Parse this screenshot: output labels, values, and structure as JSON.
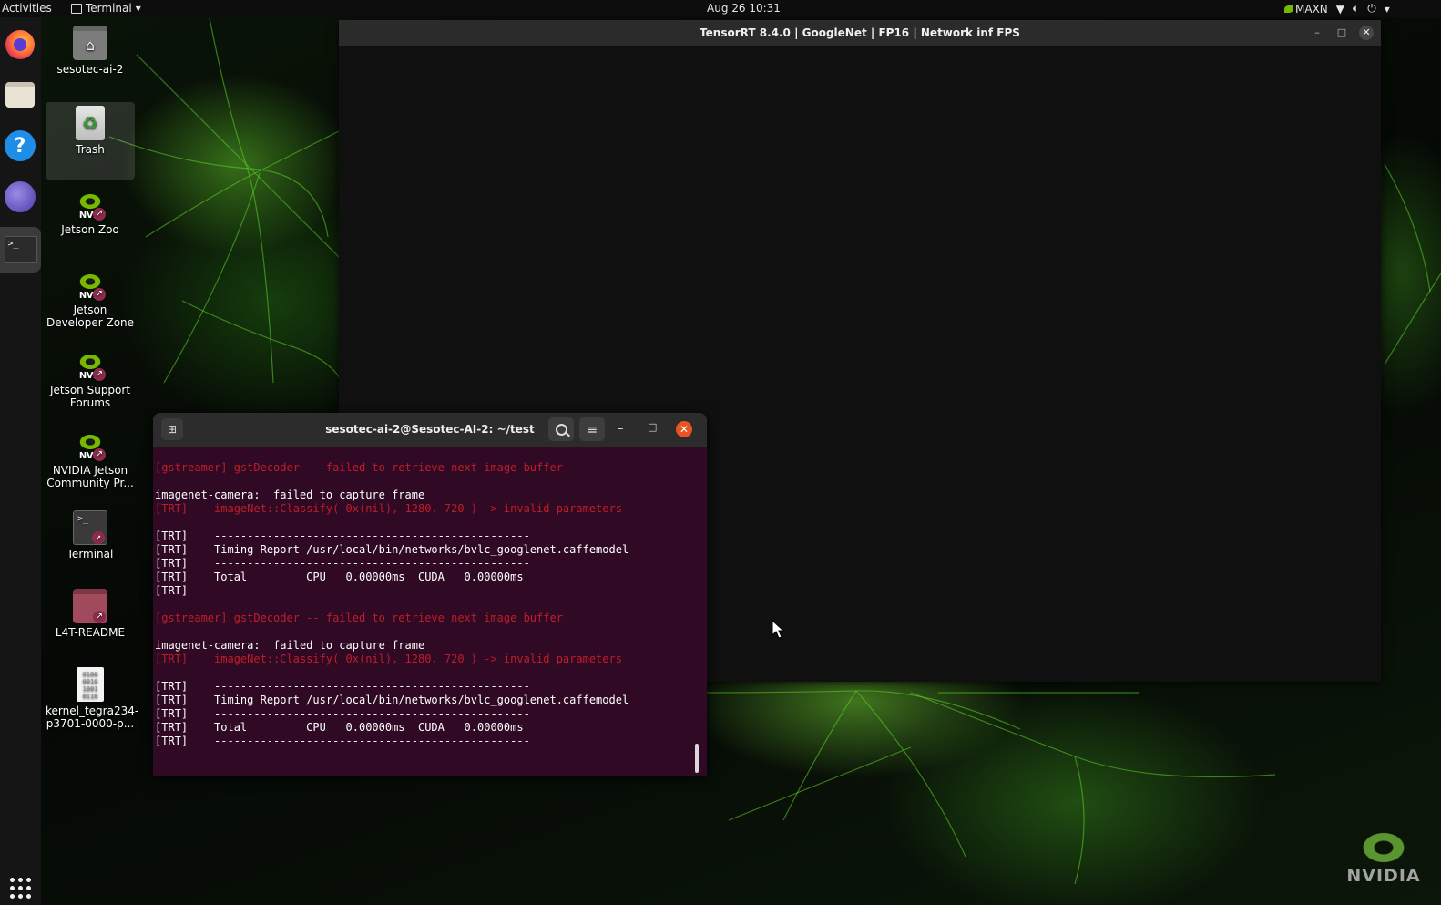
{
  "topbar": {
    "activities": "Activities",
    "app_menu": "Terminal",
    "clock": "Aug 26  10:31",
    "power_mode": "MAXN"
  },
  "dock": {
    "items": [
      {
        "name": "firefox",
        "icon": "firefox-icon"
      },
      {
        "name": "files",
        "icon": "files-icon"
      },
      {
        "name": "help",
        "icon": "help-icon",
        "glyph": "?"
      },
      {
        "name": "web",
        "icon": "web-icon"
      },
      {
        "name": "terminal",
        "icon": "terminal-icon",
        "glyph": ">_"
      },
      {
        "name": "show-apps",
        "icon": "apps-grid-icon"
      }
    ]
  },
  "desktop_icons": [
    {
      "label": "sesotec-ai-2",
      "icon": "home-folder-icon"
    },
    {
      "label": "Trash",
      "icon": "trash-icon"
    },
    {
      "label": "Jetson Zoo",
      "icon": "nvidia-link-icon"
    },
    {
      "label": "Jetson Developer Zone",
      "icon": "nvidia-link-icon"
    },
    {
      "label": "Jetson Support Forums",
      "icon": "nvidia-link-icon"
    },
    {
      "label": "NVIDIA Jetson Community Pr...",
      "icon": "nvidia-link-icon"
    },
    {
      "label": "Terminal",
      "icon": "terminal-link-icon"
    },
    {
      "label": "L4T-README",
      "icon": "folder-link-icon"
    },
    {
      "label": "kernel_tegra234-p3701-0000-p...",
      "icon": "binary-file-icon"
    }
  ],
  "nvidia_text": "NVIDIA",
  "trt_window": {
    "title": "TensorRT 8.4.0 | GoogleNet | FP16 | Network inf FPS"
  },
  "terminal_window": {
    "title": "sesotec-ai-2@Sesotec-AI-2: ~/test",
    "lines": [
      {
        "text": "[gstreamer] gstDecoder -- failed to retrieve next image buffer",
        "style": "err"
      },
      {
        "text": "",
        "style": "norm"
      },
      {
        "text": "imagenet-camera:  failed to capture frame",
        "style": "norm"
      },
      {
        "text": "[TRT]    imageNet::Classify( 0x(nil), 1280, 720 ) -> invalid parameters",
        "style": "err"
      },
      {
        "text": "",
        "style": "norm"
      },
      {
        "text": "[TRT]    ------------------------------------------------",
        "style": "norm"
      },
      {
        "text": "[TRT]    Timing Report /usr/local/bin/networks/bvlc_googlenet.caffemodel",
        "style": "norm"
      },
      {
        "text": "[TRT]    ------------------------------------------------",
        "style": "norm"
      },
      {
        "text": "[TRT]    Total         CPU   0.00000ms  CUDA   0.00000ms",
        "style": "norm"
      },
      {
        "text": "[TRT]    ------------------------------------------------",
        "style": "norm"
      },
      {
        "text": "",
        "style": "norm"
      },
      {
        "text": "[gstreamer] gstDecoder -- failed to retrieve next image buffer",
        "style": "err"
      },
      {
        "text": "",
        "style": "norm"
      },
      {
        "text": "imagenet-camera:  failed to capture frame",
        "style": "norm"
      },
      {
        "text": "[TRT]    imageNet::Classify( 0x(nil), 1280, 720 ) -> invalid parameters",
        "style": "err"
      },
      {
        "text": "",
        "style": "norm"
      },
      {
        "text": "[TRT]    ------------------------------------------------",
        "style": "norm"
      },
      {
        "text": "[TRT]    Timing Report /usr/local/bin/networks/bvlc_googlenet.caffemodel",
        "style": "norm"
      },
      {
        "text": "[TRT]    ------------------------------------------------",
        "style": "norm"
      },
      {
        "text": "[TRT]    Total         CPU   0.00000ms  CUDA   0.00000ms",
        "style": "norm"
      },
      {
        "text": "[TRT]    ------------------------------------------------",
        "style": "norm"
      }
    ]
  },
  "colors": {
    "terminal_bg": "#300a24",
    "error_text": "#c01c28",
    "close_button": "#e95420",
    "nvidia_green": "#76b900"
  }
}
